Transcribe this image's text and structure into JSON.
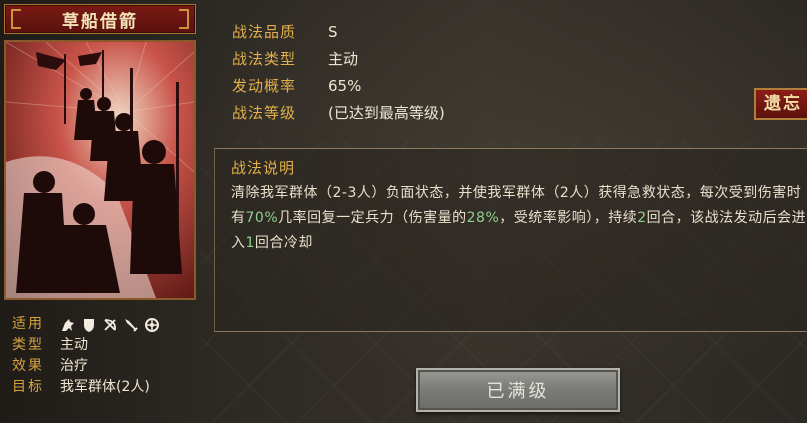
{
  "card": {
    "name": "草船借箭"
  },
  "attributes": [
    {
      "key": "适用",
      "value": ""
    },
    {
      "key": "类型",
      "value": "主动"
    },
    {
      "key": "效果",
      "value": "治疗"
    },
    {
      "key": "目标",
      "value": "我军群体(2人)"
    }
  ],
  "applicable_icons": [
    "cavalry-icon",
    "shield-icon",
    "archer-icon",
    "spear-icon",
    "siege-icon"
  ],
  "stats": [
    {
      "key": "战法品质",
      "value": "S"
    },
    {
      "key": "战法类型",
      "value": "主动"
    },
    {
      "key": "发动概率",
      "value": "65%"
    },
    {
      "key": "战法等级",
      "value": "(已达到最高等级)"
    }
  ],
  "side_tag": "遗忘",
  "description": {
    "title": "战法说明",
    "segments": [
      {
        "text": "清除我军群体（2-3人）负面状态，并使我军群体（2人）获得急救状态，每次受到伤害时有",
        "highlight": false
      },
      {
        "text": "70%",
        "highlight": true
      },
      {
        "text": "几率回复一定兵力（伤害量的",
        "highlight": false
      },
      {
        "text": "28%",
        "highlight": true
      },
      {
        "text": "，受统率影响），持续",
        "highlight": false
      },
      {
        "text": "2",
        "highlight": true
      },
      {
        "text": "回合，该战法发动后会进入",
        "highlight": false
      },
      {
        "text": "1",
        "highlight": true
      },
      {
        "text": "回合冷却",
        "highlight": false
      }
    ]
  },
  "button": {
    "label": "已满级"
  },
  "colors": {
    "gold": "#e2b04a",
    "highlight_green": "#8fd08a",
    "banner_red": "#7a1a14"
  }
}
